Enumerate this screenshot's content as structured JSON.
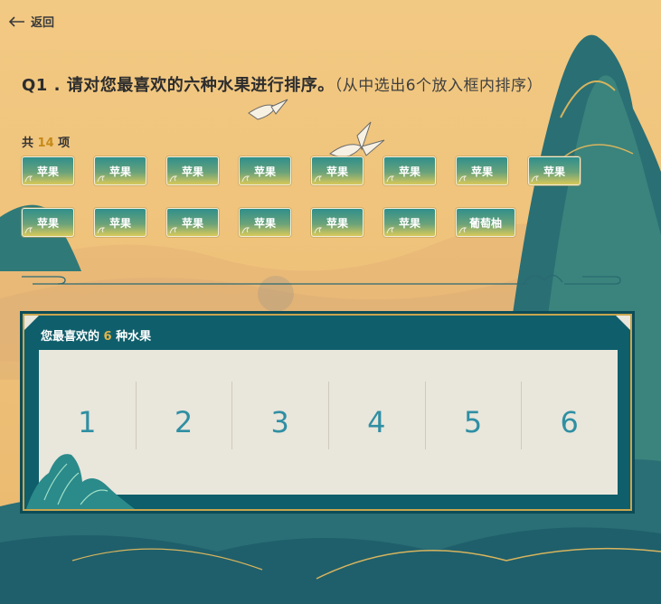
{
  "nav": {
    "back_label": "返回"
  },
  "question": {
    "number": "Q1 .",
    "text": "请对您最喜欢的六种水果进行排序。",
    "hint": "（从中选出6个放入框内排序）"
  },
  "options": {
    "total_prefix": "共",
    "total_count": "14",
    "total_suffix": "项",
    "items": [
      "苹果",
      "苹果",
      "苹果",
      "苹果",
      "苹果",
      "苹果",
      "苹果",
      "苹果",
      "苹果",
      "苹果",
      "苹果",
      "苹果",
      "苹果",
      "苹果",
      "葡萄柚"
    ]
  },
  "ranking": {
    "title_prefix": "您最喜欢的",
    "title_count": "6",
    "title_suffix": "种水果",
    "slots": [
      "1",
      "2",
      "3",
      "4",
      "5",
      "6"
    ]
  },
  "colors": {
    "background": "#efc27a",
    "panel": "#0f5e6b",
    "accent_gold": "#c9a54e",
    "slot_number": "#2f8fa3"
  }
}
